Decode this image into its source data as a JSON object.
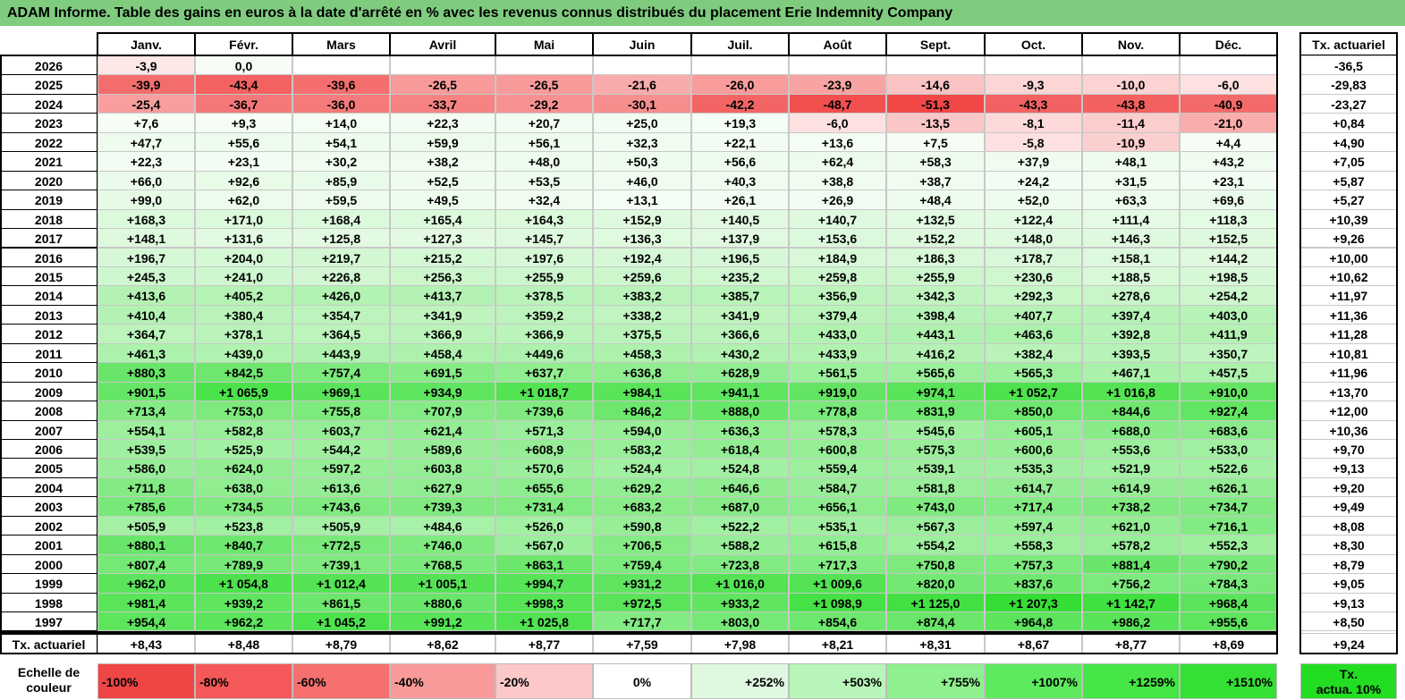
{
  "title": "ADAM Informe. Table des gains en euros à la date d'arrêté en % avec les revenus connus distribués du placement Erie Indemnity Company",
  "months": [
    "Janv.",
    "Févr.",
    "Mars",
    "Avril",
    "Mai",
    "Juin",
    "Juil.",
    "Août",
    "Sept.",
    "Oct.",
    "Nov.",
    "Déc."
  ],
  "actuarial_header": "Tx. actuariel",
  "rows": [
    {
      "year": "2026",
      "values": [
        "-3,9",
        "0,0",
        "",
        "",
        "",
        "",
        "",
        "",
        "",
        "",
        "",
        ""
      ],
      "actuarial": "-36,5"
    },
    {
      "year": "2025",
      "values": [
        "-39,9",
        "-43,4",
        "-39,6",
        "-26,5",
        "-26,5",
        "-21,6",
        "-26,0",
        "-23,9",
        "-14,6",
        "-9,3",
        "-10,0",
        "-6,0"
      ],
      "actuarial": "-29,83"
    },
    {
      "year": "2024",
      "values": [
        "-25,4",
        "-36,7",
        "-36,0",
        "-33,7",
        "-29,2",
        "-30,1",
        "-42,2",
        "-48,7",
        "-51,3",
        "-43,3",
        "-43,8",
        "-40,9"
      ],
      "actuarial": "-23,27"
    },
    {
      "year": "2023",
      "values": [
        "+7,6",
        "+9,3",
        "+14,0",
        "+22,3",
        "+20,7",
        "+25,0",
        "+19,3",
        "-6,0",
        "-13,5",
        "-8,1",
        "-11,4",
        "-21,0"
      ],
      "actuarial": "+0,84"
    },
    {
      "year": "2022",
      "values": [
        "+47,7",
        "+55,6",
        "+54,1",
        "+59,9",
        "+56,1",
        "+32,3",
        "+22,1",
        "+13,6",
        "+7,5",
        "-5,8",
        "-10,9",
        "+4,4"
      ],
      "actuarial": "+4,90"
    },
    {
      "year": "2021",
      "values": [
        "+22,3",
        "+23,1",
        "+30,2",
        "+38,2",
        "+48,0",
        "+50,3",
        "+56,6",
        "+62,4",
        "+58,3",
        "+37,9",
        "+48,1",
        "+43,2"
      ],
      "actuarial": "+7,05"
    },
    {
      "year": "2020",
      "values": [
        "+66,0",
        "+92,6",
        "+85,9",
        "+52,5",
        "+53,5",
        "+46,0",
        "+40,3",
        "+38,8",
        "+38,7",
        "+24,2",
        "+31,5",
        "+23,1"
      ],
      "actuarial": "+5,87"
    },
    {
      "year": "2019",
      "values": [
        "+99,0",
        "+62,0",
        "+59,5",
        "+49,5",
        "+32,4",
        "+13,1",
        "+26,1",
        "+26,9",
        "+48,4",
        "+52,0",
        "+63,3",
        "+69,6"
      ],
      "actuarial": "+5,27"
    },
    {
      "year": "2018",
      "values": [
        "+168,3",
        "+171,0",
        "+168,4",
        "+165,4",
        "+164,3",
        "+152,9",
        "+140,5",
        "+140,7",
        "+132,5",
        "+122,4",
        "+111,4",
        "+118,3"
      ],
      "actuarial": "+10,39"
    },
    {
      "year": "2017",
      "values": [
        "+148,1",
        "+131,6",
        "+125,8",
        "+127,3",
        "+145,7",
        "+136,3",
        "+137,9",
        "+153,6",
        "+152,2",
        "+148,0",
        "+146,3",
        "+152,5"
      ],
      "actuarial": "+9,26"
    },
    {
      "year": "2016",
      "values": [
        "+196,7",
        "+204,0",
        "+219,7",
        "+215,2",
        "+197,6",
        "+192,4",
        "+196,5",
        "+184,9",
        "+186,3",
        "+178,7",
        "+158,1",
        "+144,2"
      ],
      "actuarial": "+10,00"
    },
    {
      "year": "2015",
      "values": [
        "+245,3",
        "+241,0",
        "+226,8",
        "+256,3",
        "+255,9",
        "+259,6",
        "+235,2",
        "+259,8",
        "+255,9",
        "+230,6",
        "+188,5",
        "+198,5"
      ],
      "actuarial": "+10,62"
    },
    {
      "year": "2014",
      "values": [
        "+413,6",
        "+405,2",
        "+426,0",
        "+413,7",
        "+378,5",
        "+383,2",
        "+385,7",
        "+356,9",
        "+342,3",
        "+292,3",
        "+278,6",
        "+254,2"
      ],
      "actuarial": "+11,97"
    },
    {
      "year": "2013",
      "values": [
        "+410,4",
        "+380,4",
        "+354,7",
        "+341,9",
        "+359,2",
        "+338,2",
        "+341,9",
        "+379,4",
        "+398,4",
        "+407,7",
        "+397,4",
        "+403,0"
      ],
      "actuarial": "+11,36"
    },
    {
      "year": "2012",
      "values": [
        "+364,7",
        "+378,1",
        "+364,5",
        "+366,9",
        "+366,9",
        "+375,5",
        "+366,6",
        "+433,0",
        "+443,1",
        "+463,6",
        "+392,8",
        "+411,9"
      ],
      "actuarial": "+11,28"
    },
    {
      "year": "2011",
      "values": [
        "+461,3",
        "+439,0",
        "+443,9",
        "+458,4",
        "+449,6",
        "+458,3",
        "+430,2",
        "+433,9",
        "+416,2",
        "+382,4",
        "+393,5",
        "+350,7"
      ],
      "actuarial": "+10,81"
    },
    {
      "year": "2010",
      "values": [
        "+880,3",
        "+842,5",
        "+757,4",
        "+691,5",
        "+637,7",
        "+636,8",
        "+628,9",
        "+561,5",
        "+565,6",
        "+565,3",
        "+467,1",
        "+457,5"
      ],
      "actuarial": "+11,96"
    },
    {
      "year": "2009",
      "values": [
        "+901,5",
        "+1 065,9",
        "+969,1",
        "+934,9",
        "+1 018,7",
        "+984,1",
        "+941,1",
        "+919,0",
        "+974,1",
        "+1 052,7",
        "+1 016,8",
        "+910,0"
      ],
      "actuarial": "+13,70"
    },
    {
      "year": "2008",
      "values": [
        "+713,4",
        "+753,0",
        "+755,8",
        "+707,9",
        "+739,6",
        "+846,2",
        "+888,0",
        "+778,8",
        "+831,9",
        "+850,0",
        "+844,6",
        "+927,4"
      ],
      "actuarial": "+12,00"
    },
    {
      "year": "2007",
      "values": [
        "+554,1",
        "+582,8",
        "+603,7",
        "+621,4",
        "+571,3",
        "+594,0",
        "+636,3",
        "+578,3",
        "+545,6",
        "+605,1",
        "+688,0",
        "+683,6"
      ],
      "actuarial": "+10,36"
    },
    {
      "year": "2006",
      "values": [
        "+539,5",
        "+525,9",
        "+544,2",
        "+589,6",
        "+608,9",
        "+583,2",
        "+618,4",
        "+600,8",
        "+575,3",
        "+600,6",
        "+553,6",
        "+533,0"
      ],
      "actuarial": "+9,70"
    },
    {
      "year": "2005",
      "values": [
        "+586,0",
        "+624,0",
        "+597,2",
        "+603,8",
        "+570,6",
        "+524,4",
        "+524,8",
        "+559,4",
        "+539,1",
        "+535,3",
        "+521,9",
        "+522,6"
      ],
      "actuarial": "+9,13"
    },
    {
      "year": "2004",
      "values": [
        "+711,8",
        "+638,0",
        "+613,6",
        "+627,9",
        "+655,6",
        "+629,2",
        "+646,6",
        "+584,7",
        "+581,8",
        "+614,7",
        "+614,9",
        "+626,1"
      ],
      "actuarial": "+9,20"
    },
    {
      "year": "2003",
      "values": [
        "+785,6",
        "+734,5",
        "+743,6",
        "+739,3",
        "+731,4",
        "+683,2",
        "+687,0",
        "+656,1",
        "+743,0",
        "+717,4",
        "+738,2",
        "+734,7"
      ],
      "actuarial": "+9,49"
    },
    {
      "year": "2002",
      "values": [
        "+505,9",
        "+523,8",
        "+505,9",
        "+484,6",
        "+526,0",
        "+590,8",
        "+522,2",
        "+535,1",
        "+567,3",
        "+597,4",
        "+621,0",
        "+716,1"
      ],
      "actuarial": "+8,08"
    },
    {
      "year": "2001",
      "values": [
        "+880,1",
        "+840,7",
        "+772,5",
        "+746,0",
        "+567,0",
        "+706,5",
        "+588,2",
        "+615,8",
        "+554,2",
        "+558,3",
        "+578,2",
        "+552,3"
      ],
      "actuarial": "+8,30"
    },
    {
      "year": "2000",
      "values": [
        "+807,4",
        "+789,9",
        "+739,1",
        "+768,5",
        "+863,1",
        "+759,4",
        "+723,8",
        "+717,3",
        "+750,8",
        "+757,3",
        "+881,4",
        "+790,2"
      ],
      "actuarial": "+8,79"
    },
    {
      "year": "1999",
      "values": [
        "+962,0",
        "+1 054,8",
        "+1 012,4",
        "+1 005,1",
        "+994,7",
        "+931,2",
        "+1 016,0",
        "+1 009,6",
        "+820,0",
        "+837,6",
        "+756,2",
        "+784,3"
      ],
      "actuarial": "+9,05"
    },
    {
      "year": "1998",
      "values": [
        "+981,4",
        "+939,2",
        "+861,5",
        "+880,6",
        "+998,3",
        "+972,5",
        "+933,2",
        "+1 098,9",
        "+1 125,0",
        "+1 207,3",
        "+1 142,7",
        "+968,4"
      ],
      "actuarial": "+9,13"
    },
    {
      "year": "1997",
      "values": [
        "+954,4",
        "+962,2",
        "+1 045,2",
        "+991,2",
        "+1 025,8",
        "+717,7",
        "+803,0",
        "+854,6",
        "+874,4",
        "+964,8",
        "+986,2",
        "+955,6"
      ],
      "actuarial": "+8,50"
    }
  ],
  "footer": {
    "label": "Tx. actuariel",
    "values": [
      "+8,43",
      "+8,48",
      "+8,79",
      "+8,62",
      "+8,77",
      "+7,59",
      "+7,98",
      "+8,21",
      "+8,31",
      "+8,67",
      "+8,77",
      "+8,69"
    ],
    "actuarial": "+9,24"
  },
  "legend": {
    "label_line1": "Echelle de",
    "label_line2": "couleur",
    "cells": [
      {
        "text": "-100%",
        "color": "#f04545",
        "align": "left"
      },
      {
        "text": "-80%",
        "color": "#f45858",
        "align": "left"
      },
      {
        "text": "-60%",
        "color": "#f67070",
        "align": "left"
      },
      {
        "text": "-40%",
        "color": "#f99a9a",
        "align": "left"
      },
      {
        "text": "-20%",
        "color": "#fcc8c8",
        "align": "left"
      },
      {
        "text": "0%",
        "color": "#ffffff",
        "align": "center"
      },
      {
        "text": "+252%",
        "color": "#dff8df",
        "align": "right"
      },
      {
        "text": "+503%",
        "color": "#b8f5b8",
        "align": "right"
      },
      {
        "text": "+755%",
        "color": "#8ef08e",
        "align": "right"
      },
      {
        "text": "+1007%",
        "color": "#5eea5e",
        "align": "right"
      },
      {
        "text": "+1259%",
        "color": "#45e645",
        "align": "right"
      },
      {
        "text": "+1510%",
        "color": "#35e035",
        "align": "right"
      }
    ],
    "final_line1": "Tx.",
    "final_line2": "actua. 10%",
    "final_color": "#22dd22"
  }
}
